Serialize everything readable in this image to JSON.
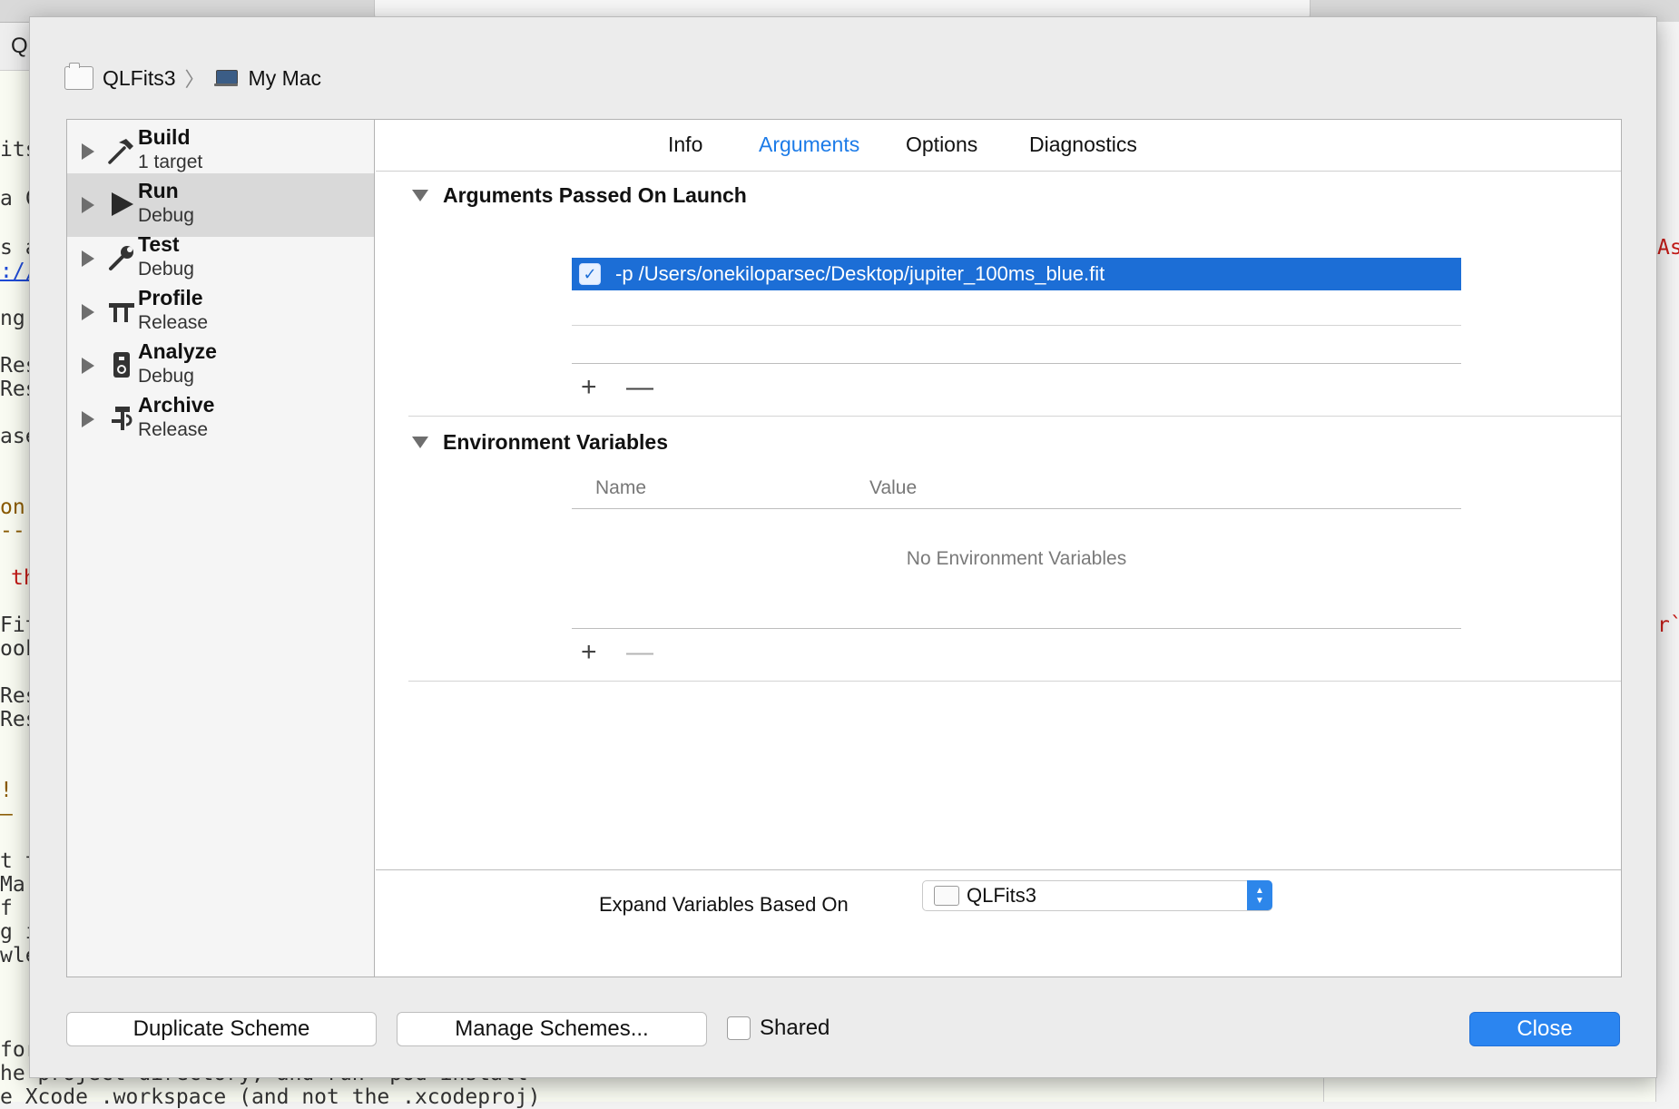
{
  "sheet": {
    "breadcrumb": {
      "project": "QLFits3",
      "destination": "My Mac"
    },
    "actions": [
      {
        "name": "Build",
        "subtitle": "1 target",
        "icon": "hammer-icon"
      },
      {
        "name": "Run",
        "subtitle": "Debug",
        "icon": "play-icon",
        "selected": true
      },
      {
        "name": "Test",
        "subtitle": "Debug",
        "icon": "wrench-icon"
      },
      {
        "name": "Profile",
        "subtitle": "Release",
        "icon": "caliper-icon"
      },
      {
        "name": "Analyze",
        "subtitle": "Debug",
        "icon": "analyze-icon"
      },
      {
        "name": "Archive",
        "subtitle": "Release",
        "icon": "archive-icon"
      }
    ],
    "tabs": [
      "Info",
      "Arguments",
      "Options",
      "Diagnostics"
    ],
    "active_tab": "Arguments",
    "arguments_section": {
      "title": "Arguments Passed On Launch",
      "arguments": [
        {
          "enabled": true,
          "value": "-p /Users/onekiloparsec/Desktop/jupiter_100ms_blue.fit"
        }
      ]
    },
    "env_section": {
      "title": "Environment Variables",
      "col_name": "Name",
      "col_value": "Value",
      "empty_message": "No Environment Variables"
    },
    "expand_label": "Expand Variables Based On",
    "expand_value": "QLFits3",
    "buttons": {
      "duplicate": "Duplicate Scheme",
      "manage": "Manage Schemes...",
      "shared": "Shared",
      "close": "Close"
    },
    "glyphs": {
      "plus": "+",
      "minus": "—",
      "check": "✓"
    }
  },
  "background": {
    "tab_title": "QL",
    "code_fragments": [
      "its",
      "a C",
      "s a",
      "://",
      "ng",
      "Res",
      "Res",
      "ase",
      "on",
      "--",
      "th",
      "Fit",
      "ook",
      "Res",
      "Res",
      "!",
      "–",
      "t t",
      "Ma",
      "f",
      "g i",
      "wle",
      "for",
      "he project directory, and run `pod install`",
      "e Xcode .workspace (and not the .xcodeproj)",
      "As",
      "r`"
    ]
  },
  "colors": {
    "accent": "#1c7be8",
    "selection": "#1c6ed6",
    "primary_button": "#2b85f0"
  }
}
